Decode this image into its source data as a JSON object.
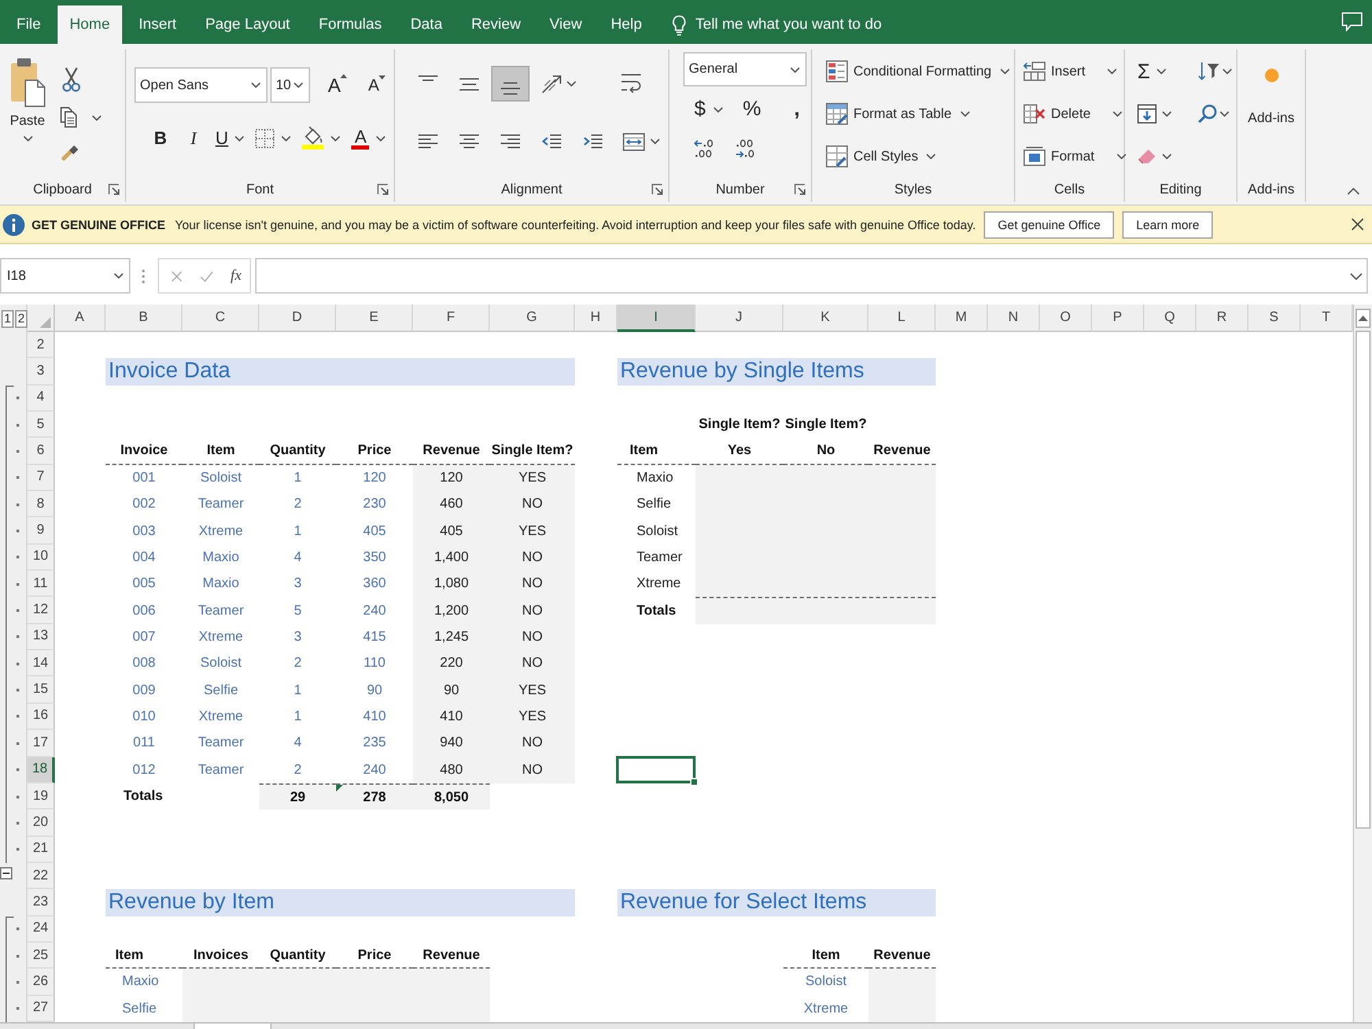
{
  "tabs": [
    {
      "label": "File",
      "selected": false
    },
    {
      "label": "Home",
      "selected": true
    },
    {
      "label": "Insert",
      "selected": false
    },
    {
      "label": "Page Layout",
      "selected": false
    },
    {
      "label": "Formulas",
      "selected": false
    },
    {
      "label": "Data",
      "selected": false
    },
    {
      "label": "Review",
      "selected": false
    },
    {
      "label": "View",
      "selected": false
    },
    {
      "label": "Help",
      "selected": false
    }
  ],
  "tell_me": {
    "placeholder": "Tell me what you want to do"
  },
  "ribbon": {
    "groups": [
      {
        "kind": "clipboard",
        "label": "Clipboard",
        "launcher": true,
        "paste": "Paste"
      },
      {
        "kind": "font",
        "label": "Font",
        "launcher": true,
        "font_name": "Open Sans",
        "font_size": "10",
        "grow_font": "A",
        "shrink_font": "A",
        "bold": "B",
        "italic": "I",
        "underline": "U",
        "font_color": "A"
      },
      {
        "kind": "alignment",
        "label": "Alignment",
        "launcher": true,
        "buttons": [
          {
            "kind": "align_top",
            "on": false
          },
          {
            "kind": "align_middle",
            "on": false
          },
          {
            "kind": "align_bottom",
            "on": true
          },
          {
            "kind": "orientation",
            "on": false
          },
          {
            "kind": "wrap_text",
            "on": false
          },
          {
            "kind": "align_left",
            "on": false
          },
          {
            "kind": "align_center",
            "on": false
          },
          {
            "kind": "align_right",
            "on": false
          },
          {
            "kind": "decrease_indent",
            "on": false
          },
          {
            "kind": "increase_indent",
            "on": false
          },
          {
            "kind": "merge_center",
            "on": false
          }
        ]
      },
      {
        "kind": "number",
        "label": "Number",
        "launcher": true,
        "format": "General",
        "currency": "$",
        "percent": "%",
        "comma": ","
      },
      {
        "kind": "styles",
        "label": "Styles",
        "launcher": false,
        "items": [
          {
            "kind": "conditional",
            "label": "Conditional Formatting"
          },
          {
            "kind": "table",
            "label": "Format as Table"
          },
          {
            "kind": "cell_styles",
            "label": "Cell Styles"
          }
        ]
      },
      {
        "kind": "cells",
        "label": "Cells",
        "launcher": false,
        "items": [
          {
            "kind": "insert",
            "label": "Insert"
          },
          {
            "kind": "delete",
            "label": "Delete"
          },
          {
            "kind": "format",
            "label": "Format"
          }
        ]
      },
      {
        "kind": "editing",
        "label": "Editing",
        "launcher": false,
        "autosum": "Σ"
      },
      {
        "kind": "addins",
        "label": "Add-ins",
        "launcher": false,
        "button": "Add-ins"
      }
    ]
  },
  "message_bar": {
    "title": "GET GENUINE OFFICE",
    "text": "Your license isn't genuine, and you may be a victim of software counterfeiting. Avoid interruption and keep your files safe with genuine Office today.",
    "buttons": [
      "Get genuine Office",
      "Learn more"
    ]
  },
  "formula_bar": {
    "name_box": "I18",
    "function": "fx"
  },
  "sheet": {
    "outline_levels": [
      "1",
      "2"
    ],
    "columns": [
      {
        "label": "A",
        "selected": false
      },
      {
        "label": "B",
        "selected": false
      },
      {
        "label": "C",
        "selected": false
      },
      {
        "label": "D",
        "selected": false
      },
      {
        "label": "E",
        "selected": false
      },
      {
        "label": "F",
        "selected": false
      },
      {
        "label": "G",
        "selected": false
      },
      {
        "label": "H",
        "selected": false
      },
      {
        "label": "I",
        "selected": true
      },
      {
        "label": "J",
        "selected": false
      },
      {
        "label": "K",
        "selected": false
      },
      {
        "label": "L",
        "selected": false
      },
      {
        "label": "M",
        "selected": false
      },
      {
        "label": "N",
        "selected": false
      },
      {
        "label": "O",
        "selected": false
      },
      {
        "label": "P",
        "selected": false
      },
      {
        "label": "Q",
        "selected": false
      },
      {
        "label": "R",
        "selected": false
      },
      {
        "label": "S",
        "selected": false
      },
      {
        "label": "T",
        "selected": false
      }
    ],
    "rows": [
      {
        "label": "2",
        "selected": false,
        "grouped": false,
        "collapsible": false
      },
      {
        "label": "3",
        "selected": false,
        "grouped": false,
        "collapsible": false
      },
      {
        "label": "4",
        "selected": false,
        "grouped": true,
        "collapsible": false
      },
      {
        "label": "5",
        "selected": false,
        "grouped": true,
        "collapsible": false
      },
      {
        "label": "6",
        "selected": false,
        "grouped": true,
        "collapsible": false
      },
      {
        "label": "7",
        "selected": false,
        "grouped": true,
        "collapsible": false
      },
      {
        "label": "8",
        "selected": false,
        "grouped": true,
        "collapsible": false
      },
      {
        "label": "9",
        "selected": false,
        "grouped": true,
        "collapsible": false
      },
      {
        "label": "10",
        "selected": false,
        "grouped": true,
        "collapsible": false
      },
      {
        "label": "11",
        "selected": false,
        "grouped": true,
        "collapsible": false
      },
      {
        "label": "12",
        "selected": false,
        "grouped": true,
        "collapsible": false
      },
      {
        "label": "13",
        "selected": false,
        "grouped": true,
        "collapsible": false
      },
      {
        "label": "14",
        "selected": false,
        "grouped": true,
        "collapsible": false
      },
      {
        "label": "15",
        "selected": false,
        "grouped": true,
        "collapsible": false
      },
      {
        "label": "16",
        "selected": false,
        "grouped": true,
        "collapsible": false
      },
      {
        "label": "17",
        "selected": false,
        "grouped": true,
        "collapsible": false
      },
      {
        "label": "18",
        "selected": true,
        "grouped": true,
        "collapsible": false
      },
      {
        "label": "19",
        "selected": false,
        "grouped": true,
        "collapsible": false
      },
      {
        "label": "20",
        "selected": false,
        "grouped": true,
        "collapsible": false
      },
      {
        "label": "21",
        "selected": false,
        "grouped": true,
        "collapsible": false
      },
      {
        "label": "22",
        "selected": false,
        "grouped": false,
        "collapsible": true
      },
      {
        "label": "23",
        "selected": false,
        "grouped": false,
        "collapsible": false
      },
      {
        "label": "24",
        "selected": false,
        "grouped": true,
        "collapsible": false
      },
      {
        "label": "25",
        "selected": false,
        "grouped": true,
        "collapsible": false
      },
      {
        "label": "26",
        "selected": false,
        "grouped": true,
        "collapsible": false
      },
      {
        "label": "27",
        "selected": false,
        "grouped": true,
        "collapsible": false
      }
    ],
    "sections": [
      {
        "title": "Invoice Data",
        "header": [
          "Invoice",
          "Item",
          "Quantity",
          "Price",
          "Revenue",
          "Single Item?"
        ],
        "rows": [
          [
            "001",
            "Soloist",
            "1",
            "120",
            "120",
            "YES"
          ],
          [
            "002",
            "Teamer",
            "2",
            "230",
            "460",
            "NO"
          ],
          [
            "003",
            "Xtreme",
            "1",
            "405",
            "405",
            "YES"
          ],
          [
            "004",
            "Maxio",
            "4",
            "350",
            "1,400",
            "NO"
          ],
          [
            "005",
            "Maxio",
            "3",
            "360",
            "1,080",
            "NO"
          ],
          [
            "006",
            "Teamer",
            "5",
            "240",
            "1,200",
            "NO"
          ],
          [
            "007",
            "Xtreme",
            "3",
            "415",
            "1,245",
            "NO"
          ],
          [
            "008",
            "Soloist",
            "2",
            "110",
            "220",
            "NO"
          ],
          [
            "009",
            "Selfie",
            "1",
            "90",
            "90",
            "YES"
          ],
          [
            "010",
            "Xtreme",
            "1",
            "410",
            "410",
            "YES"
          ],
          [
            "011",
            "Teamer",
            "4",
            "235",
            "940",
            "NO"
          ],
          [
            "012",
            "Teamer",
            "2",
            "240",
            "480",
            "NO"
          ]
        ],
        "totals": {
          "label": "Totals",
          "values": [
            {
              "text": "29",
              "flagged": false
            },
            {
              "text": "278",
              "flagged": true
            },
            {
              "text": "8,050",
              "flagged": false
            }
          ]
        }
      },
      {
        "title": "Revenue by Single Items",
        "super_header": [
          "Single Item?",
          "Single Item?"
        ],
        "header": [
          "Item",
          "Yes",
          "No",
          "Revenue"
        ],
        "rows": [
          [
            "Maxio"
          ],
          [
            "Selfie"
          ],
          [
            "Soloist"
          ],
          [
            "Teamer"
          ],
          [
            "Xtreme"
          ]
        ],
        "totals": {
          "label": "Totals"
        }
      },
      {
        "title": "Revenue by Item",
        "header": [
          "Item",
          "Invoices",
          "Quantity",
          "Price",
          "Revenue"
        ],
        "rows": [
          [
            "Maxio"
          ],
          [
            "Selfie"
          ]
        ]
      },
      {
        "title": "Revenue for Select Items",
        "header": [
          "Item",
          "Revenue"
        ],
        "rows": [
          [
            "Soloist"
          ],
          [
            "Xtreme"
          ]
        ]
      }
    ]
  }
}
